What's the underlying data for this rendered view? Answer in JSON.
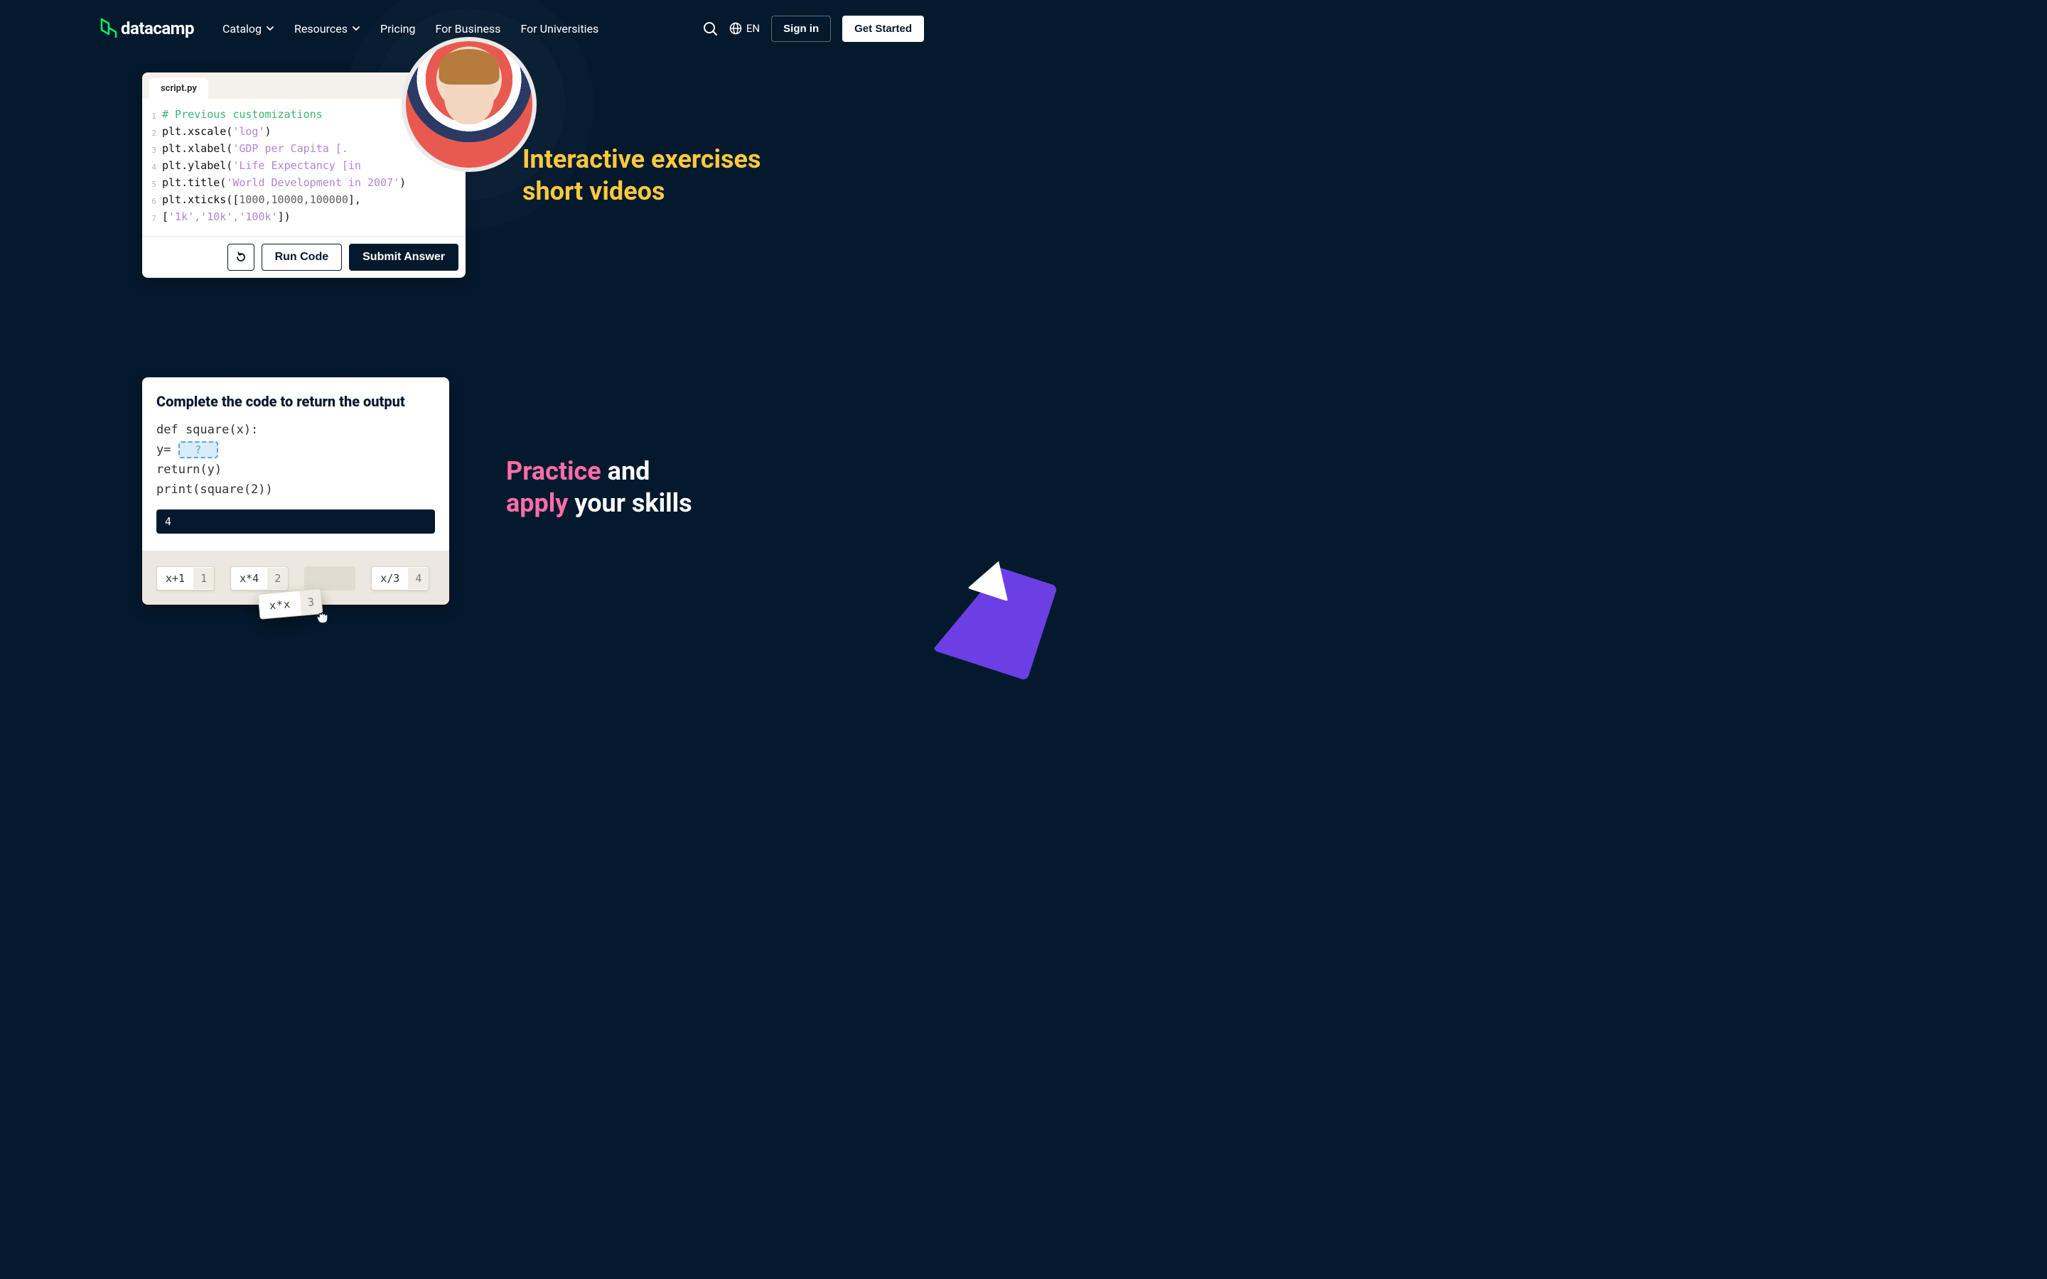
{
  "header": {
    "brand": "datacamp",
    "nav": {
      "catalog": "Catalog",
      "resources": "Resources",
      "pricing": "Pricing",
      "business": "For Business",
      "universities": "For Universities"
    },
    "lang": "EN",
    "signin": "Sign in",
    "getstarted": "Get Started"
  },
  "section1": {
    "tab": "script.py",
    "gutter": [
      "1",
      "2",
      "3",
      "4",
      "5",
      "6",
      "7"
    ],
    "code": {
      "l1_comment": "# Previous customizations",
      "l2_a": "plt.xscale(",
      "l2_s": "'log'",
      "l2_b": ")",
      "l3_a": "plt.xlabel(",
      "l3_s": "'GDP per Capita [.",
      "l3_b": "",
      "l4_a": "plt.ylabel(",
      "l4_s": "'Life Expectancy [in ",
      "l4_b": "",
      "l5_a": "plt.title(",
      "l5_s": "'World Development in 2007'",
      "l5_b": ")",
      "l6_a": "plt.xticks([",
      "l6_n": "1000,10000,100000",
      "l6_b": "],",
      "l7_a": "[",
      "l7_s": "'1k','10k','100k'",
      "l7_b": "])"
    },
    "btn_run": "Run Code",
    "btn_submit": "Submit Answer",
    "headline_l1": "Interactive exercises",
    "headline_l2": "short videos"
  },
  "section2": {
    "title": "Complete the code to return the output",
    "code": {
      "l1": "def square(x):",
      "l2a": "    y= ",
      "blank": "?",
      "l3": "    return(y)",
      "l4": "print(square(2))"
    },
    "output": "4",
    "chips": [
      {
        "label": "x+1",
        "num": "1"
      },
      {
        "label": "x*4",
        "num": "2"
      },
      {
        "label": "x/3",
        "num": "4"
      }
    ],
    "drag": {
      "label": "x*x",
      "num": "3"
    },
    "headline_p1": "Practice",
    "headline_p2": " and",
    "headline_p3": "apply",
    "headline_p4": " your skills"
  }
}
